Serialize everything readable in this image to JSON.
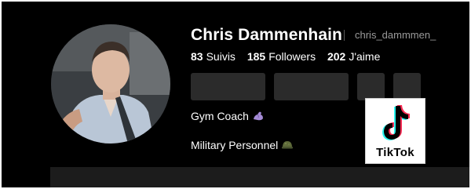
{
  "profile": {
    "name": "Chris Dammenhain",
    "handle": "chris_dammmen_",
    "avatar": "profile-photo"
  },
  "stats": [
    {
      "value": "83",
      "label": "Suivis"
    },
    {
      "value": "185",
      "label": "Followers"
    },
    {
      "value": "202",
      "label": "J'aime"
    }
  ],
  "bio": [
    {
      "text": "Gym Coach",
      "icon": "flexed-biceps-emoji"
    },
    {
      "text": "Military Personnel",
      "icon": "military-helmet-emoji"
    }
  ],
  "logo": {
    "wordmark": "TikTok",
    "icon": "tiktok-note-icon"
  },
  "colors": {
    "background": "#000000",
    "button": "#2b2b2b",
    "handle": "#9a9a9a",
    "brand_cyan": "#25F4EE",
    "brand_red": "#FE2C55"
  }
}
